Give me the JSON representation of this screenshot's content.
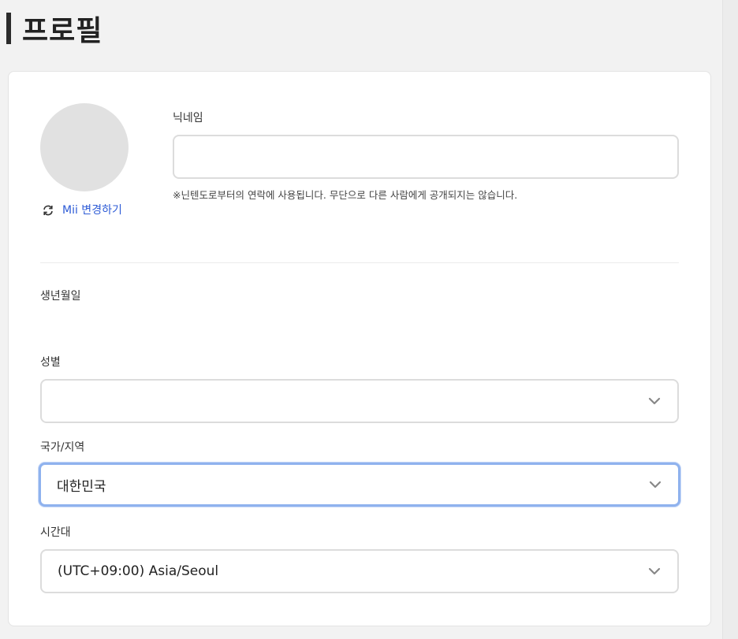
{
  "page": {
    "title": "프로필"
  },
  "profile": {
    "mii_change_label": "Mii 변경하기",
    "nickname": {
      "label": "닉네임",
      "value": "",
      "note": "※닌텐도로부터의 연락에 사용됩니다. 무단으로 다른 사람에게 공개되지는 않습니다."
    },
    "birthdate": {
      "label": "생년월일"
    },
    "gender": {
      "label": "성별",
      "value": ""
    },
    "country": {
      "label": "국가/지역",
      "value": "대한민국"
    },
    "timezone": {
      "label": "시간대",
      "value": "(UTC+09:00) Asia/Seoul"
    }
  },
  "icons": {
    "refresh": "refresh-icon",
    "chevron": "chevron-down-icon"
  },
  "colors": {
    "link": "#2d5bd6",
    "focus_border": "#8fb2ee",
    "avatar_placeholder": "#e1e1e1"
  }
}
